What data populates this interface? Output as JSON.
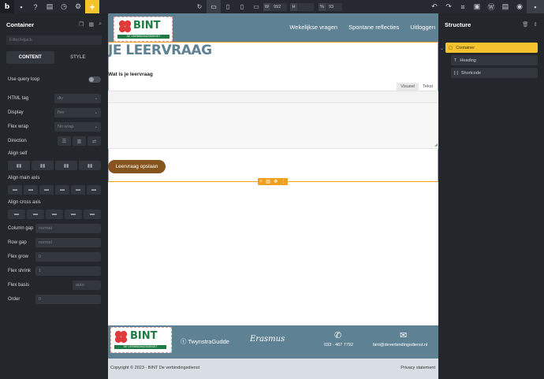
{
  "topbar": {
    "logo": "b",
    "left_icons": [
      "page-icon",
      "help-icon",
      "pages-icon",
      "history-icon",
      "settings-icon"
    ],
    "add": "+",
    "width_key": "W",
    "width_value": "992",
    "height_key": "H",
    "height_value": "",
    "zoom_key": "%",
    "zoom_value": "93"
  },
  "left_panel": {
    "title": "Container",
    "search_placeholder": "Filter/Hijack",
    "tabs": [
      "CONTENT",
      "STYLE"
    ],
    "use_query_loop": "Use query loop",
    "html_tag_label": "HTML tag",
    "html_tag_value": "div",
    "display_label": "Display",
    "display_value": "flex",
    "flex_wrap_label": "Flex wrap",
    "flex_wrap_value": "No wrap",
    "direction_label": "Direction",
    "align_self_label": "Align self",
    "align_main_label": "Align main axis",
    "align_cross_label": "Align cross axis",
    "column_gap_label": "Column gap",
    "column_gap_placeholder": "normal",
    "row_gap_label": "Row gap",
    "row_gap_placeholder": "normal",
    "flex_grow_label": "Flex grow",
    "flex_grow_placeholder": "0",
    "flex_shrink_label": "Flex shrink",
    "flex_shrink_placeholder": "1",
    "flex_basis_label": "Flex basis",
    "flex_basis_placeholder": "auto",
    "order_label": "Order",
    "order_placeholder": "0"
  },
  "site": {
    "logo_text": "BINT",
    "logo_sub": "DE VERBINDINGSDIENST",
    "nav": [
      "Wekelijkse vragen",
      "Spontane reflecties",
      "Uitloggen"
    ],
    "heading": "JE LEERVRAAG",
    "question_label": "Wat is je leervraag",
    "editor_tabs": [
      "Visueel",
      "Tekst"
    ],
    "save_button": "Leervraag opslaan",
    "footer_brand1": "TwynstraGudde",
    "footer_brand2": "Erasmus",
    "footer_phone": "033 - 467 7792",
    "footer_email": "bint@deverbindingsdienst.nl",
    "copyright": "Copyright © 2023 - BINT De verbindingsdienst",
    "privacy": "Privacy statement"
  },
  "structure": {
    "title": "Structure",
    "items": [
      "Container",
      "Heading",
      "Shortcode"
    ]
  },
  "colors": {
    "accent": "#f5c32d",
    "site_blue": "#5e8193",
    "button_brown": "#85551d",
    "selection_orange": "#f0a020"
  }
}
